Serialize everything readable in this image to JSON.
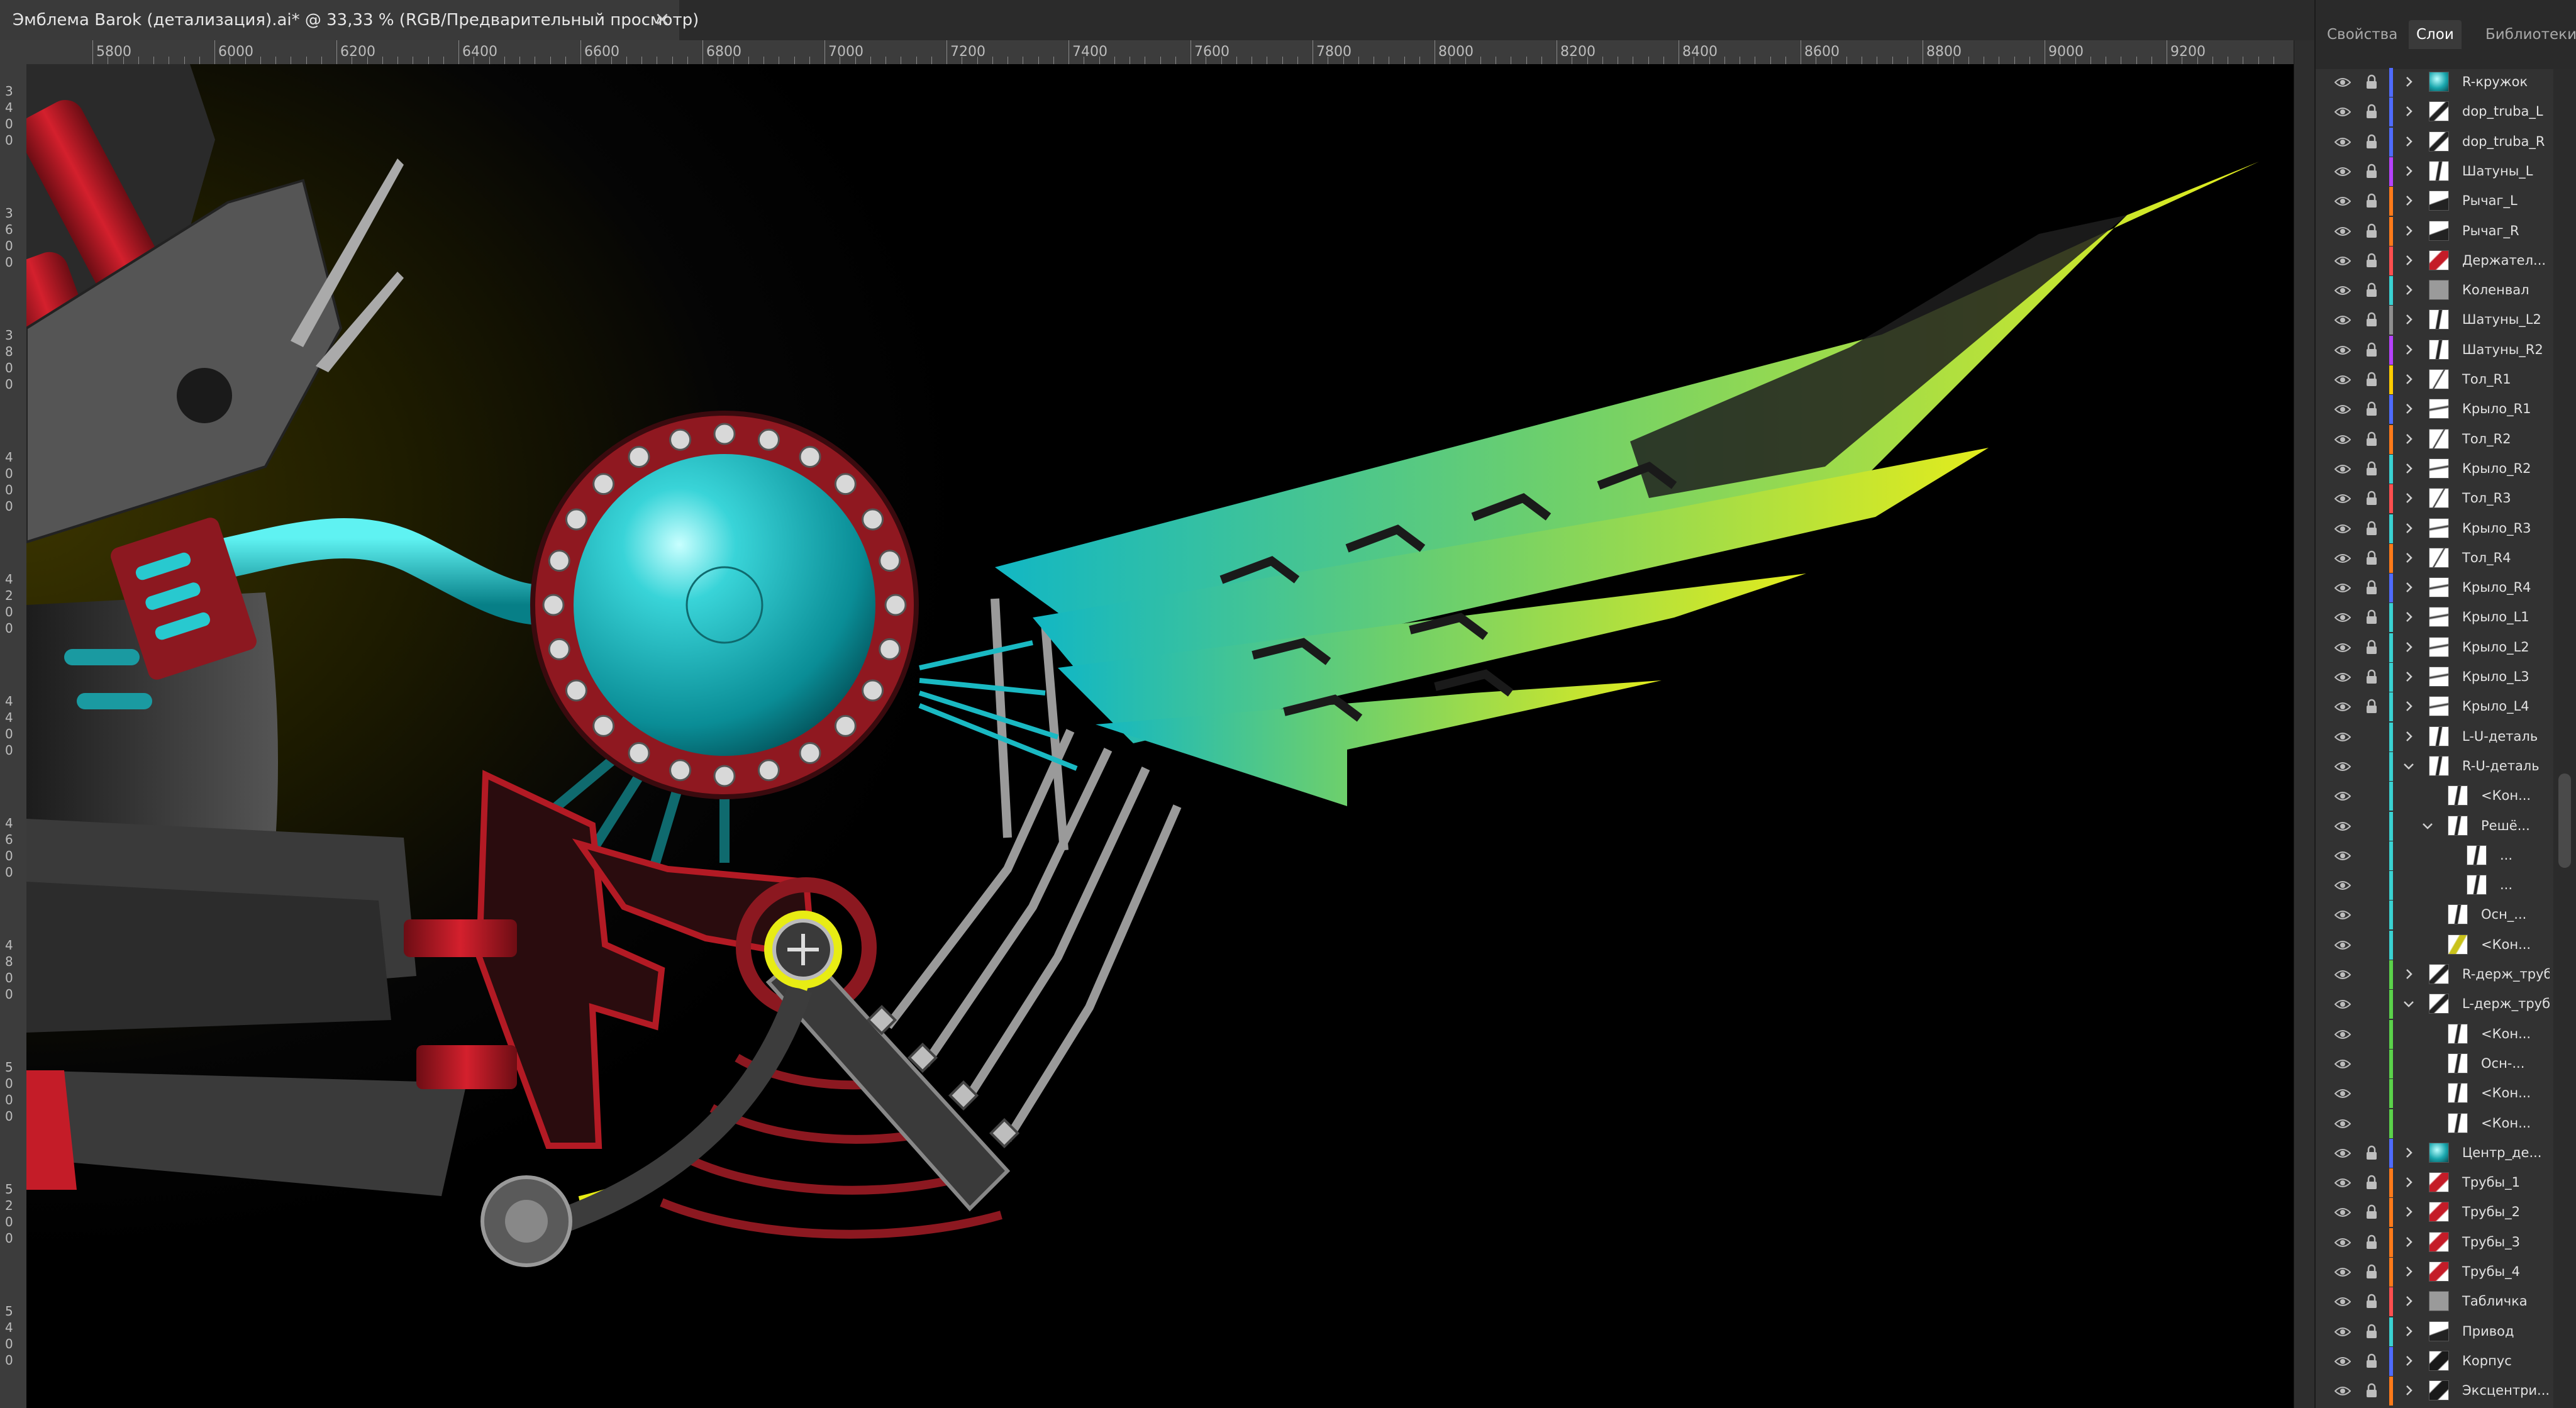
{
  "document": {
    "tab_title": "Эмблема Barok (детализация).ai* @ 33,33 % (RGB/Предварительный просмотр)",
    "close_glyph": "×"
  },
  "ruler": {
    "h_labels": [
      "5800",
      "6000",
      "6200",
      "6400",
      "6600",
      "6800",
      "7000",
      "7200",
      "7400",
      "7600",
      "7800",
      "8000",
      "8200",
      "8400",
      "8600",
      "8800",
      "9000",
      "9200"
    ],
    "v_labels": [
      "3400",
      "3600",
      "3800",
      "4000",
      "4200",
      "4400",
      "4600",
      "4800",
      "5000",
      "5200",
      "5400"
    ]
  },
  "panel": {
    "tabs": [
      "Свойства",
      "Слои",
      "Библиотеки"
    ],
    "active_tab": "Слои"
  },
  "layers": [
    {
      "name": "R-кружок",
      "depth": 0,
      "expanded": false,
      "locked": true,
      "color": "#4f6bff",
      "thumb": "orb"
    },
    {
      "name": "dop_truba_L",
      "depth": 0,
      "expanded": false,
      "locked": true,
      "color": "#4f6bff",
      "thumb": "pipe"
    },
    {
      "name": "dop_truba_R",
      "depth": 0,
      "expanded": false,
      "locked": true,
      "color": "#4f6bff",
      "thumb": "pipe"
    },
    {
      "name": "Шатуны_L",
      "depth": 0,
      "expanded": false,
      "locked": true,
      "color": "#b642ff",
      "thumb": "rod"
    },
    {
      "name": "Рычаг_L",
      "depth": 0,
      "expanded": false,
      "locked": true,
      "color": "#ff7a1a",
      "thumb": "lever"
    },
    {
      "name": "Рычаг_R",
      "depth": 0,
      "expanded": false,
      "locked": true,
      "color": "#ff7a1a",
      "thumb": "lever"
    },
    {
      "name": "Держател...",
      "depth": 0,
      "expanded": false,
      "locked": true,
      "color": "#ff4f4f",
      "thumb": "red"
    },
    {
      "name": "Коленвал",
      "depth": 0,
      "expanded": false,
      "locked": true,
      "color": "#3ad1d1",
      "thumb": "gray"
    },
    {
      "name": "Шатуны_L2",
      "depth": 0,
      "expanded": false,
      "locked": true,
      "color": "#8f8f8f",
      "thumb": "rod"
    },
    {
      "name": "Шатуны_R2",
      "depth": 0,
      "expanded": false,
      "locked": true,
      "color": "#b642ff",
      "thumb": "rod"
    },
    {
      "name": "Тол_R1",
      "depth": 0,
      "expanded": false,
      "locked": true,
      "color": "#ffcc00",
      "thumb": "bar"
    },
    {
      "name": "Крыло_R1",
      "depth": 0,
      "expanded": false,
      "locked": true,
      "color": "#4f6bff",
      "thumb": "wing"
    },
    {
      "name": "Тол_R2",
      "depth": 0,
      "expanded": false,
      "locked": true,
      "color": "#ff7a1a",
      "thumb": "bar"
    },
    {
      "name": "Крыло_R2",
      "depth": 0,
      "expanded": false,
      "locked": true,
      "color": "#3ad1d1",
      "thumb": "wing"
    },
    {
      "name": "Тол_R3",
      "depth": 0,
      "expanded": false,
      "locked": true,
      "color": "#ff4f4f",
      "thumb": "bar"
    },
    {
      "name": "Крыло_R3",
      "depth": 0,
      "expanded": false,
      "locked": true,
      "color": "#3ad1d1",
      "thumb": "wing"
    },
    {
      "name": "Тол_R4",
      "depth": 0,
      "expanded": false,
      "locked": true,
      "color": "#ff7a1a",
      "thumb": "bar"
    },
    {
      "name": "Крыло_R4",
      "depth": 0,
      "expanded": false,
      "locked": true,
      "color": "#4f6bff",
      "thumb": "wing"
    },
    {
      "name": "Крыло_L1",
      "depth": 0,
      "expanded": false,
      "locked": true,
      "color": "#3ad1d1",
      "thumb": "wing"
    },
    {
      "name": "Крыло_L2",
      "depth": 0,
      "expanded": false,
      "locked": true,
      "color": "#3ad1d1",
      "thumb": "wing"
    },
    {
      "name": "Крыло_L3",
      "depth": 0,
      "expanded": false,
      "locked": true,
      "color": "#3ad1d1",
      "thumb": "wing"
    },
    {
      "name": "Крыло_L4",
      "depth": 0,
      "expanded": false,
      "locked": true,
      "color": "#3ad1d1",
      "thumb": "wing"
    },
    {
      "name": "L-U-деталь",
      "depth": 0,
      "expanded": false,
      "locked": false,
      "color": "#3ad1d1",
      "thumb": "rod"
    },
    {
      "name": "R-U-деталь",
      "depth": 0,
      "expanded": true,
      "locked": false,
      "color": "#3ad1d1",
      "thumb": "rod"
    },
    {
      "name": "<Кон...",
      "depth": 1,
      "expanded": null,
      "locked": false,
      "color": "#3ad1d1",
      "thumb": "rod"
    },
    {
      "name": "Решё...",
      "depth": 1,
      "expanded": true,
      "locked": false,
      "color": "#3ad1d1",
      "thumb": "rod"
    },
    {
      "name": "...",
      "depth": 2,
      "expanded": null,
      "locked": false,
      "color": "#3ad1d1",
      "thumb": "rod"
    },
    {
      "name": "...",
      "depth": 2,
      "expanded": null,
      "locked": false,
      "color": "#3ad1d1",
      "thumb": "rod"
    },
    {
      "name": "Осн_...",
      "depth": 1,
      "expanded": null,
      "locked": false,
      "color": "#3ad1d1",
      "thumb": "rod"
    },
    {
      "name": "<Кон...",
      "depth": 1,
      "expanded": null,
      "locked": false,
      "color": "#3ad1d1",
      "thumb": "yellow"
    },
    {
      "name": "R-держ_труб",
      "depth": 0,
      "expanded": false,
      "locked": false,
      "color": "#5bd24a",
      "thumb": "pipe"
    },
    {
      "name": "L-держ_труб",
      "depth": 0,
      "expanded": true,
      "locked": false,
      "color": "#5bd24a",
      "thumb": "pipe"
    },
    {
      "name": "<Кон...",
      "depth": 1,
      "expanded": null,
      "locked": false,
      "color": "#5bd24a",
      "thumb": "rod"
    },
    {
      "name": "Осн-...",
      "depth": 1,
      "expanded": null,
      "locked": false,
      "color": "#5bd24a",
      "thumb": "rod"
    },
    {
      "name": "<Кон...",
      "depth": 1,
      "expanded": null,
      "locked": false,
      "color": "#5bd24a",
      "thumb": "rod"
    },
    {
      "name": "<Кон...",
      "depth": 1,
      "expanded": null,
      "locked": false,
      "color": "#5bd24a",
      "thumb": "rod"
    },
    {
      "name": "Центр_де...",
      "depth": 0,
      "expanded": false,
      "locked": true,
      "color": "#4f6bff",
      "thumb": "orb"
    },
    {
      "name": "Трубы_1",
      "depth": 0,
      "expanded": false,
      "locked": true,
      "color": "#ff7a1a",
      "thumb": "red"
    },
    {
      "name": "Трубы_2",
      "depth": 0,
      "expanded": false,
      "locked": true,
      "color": "#ff7a1a",
      "thumb": "red"
    },
    {
      "name": "Трубы_3",
      "depth": 0,
      "expanded": false,
      "locked": true,
      "color": "#ff7a1a",
      "thumb": "red"
    },
    {
      "name": "Трубы_4",
      "depth": 0,
      "expanded": false,
      "locked": true,
      "color": "#ff7a1a",
      "thumb": "red"
    },
    {
      "name": "Табличка",
      "depth": 0,
      "expanded": false,
      "locked": true,
      "color": "#ff4f4f",
      "thumb": "gray"
    },
    {
      "name": "Привод",
      "depth": 0,
      "expanded": false,
      "locked": true,
      "color": "#3ad1d1",
      "thumb": "lever"
    },
    {
      "name": "Корпус",
      "depth": 0,
      "expanded": false,
      "locked": true,
      "color": "#4f6bff",
      "thumb": "dark"
    },
    {
      "name": "Эксцентри...",
      "depth": 0,
      "expanded": false,
      "locked": true,
      "color": "#ff7a1a",
      "thumb": "dark"
    }
  ],
  "icons": {
    "visibility": "eye-icon",
    "lock": "lock-icon",
    "expand": "chevron-right-icon",
    "collapse": "chevron-down-icon"
  }
}
